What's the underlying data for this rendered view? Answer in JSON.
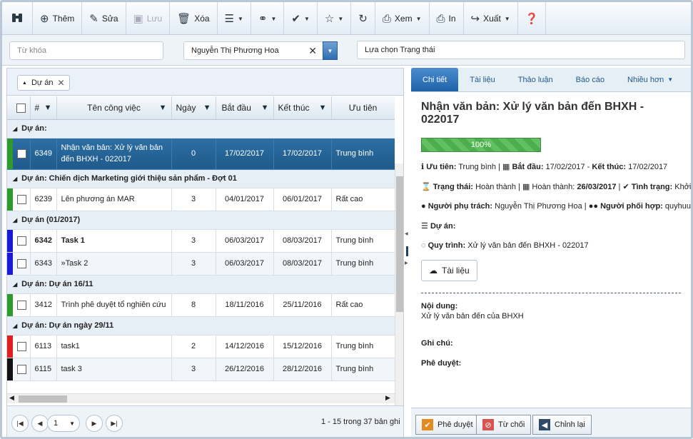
{
  "toolbar": {
    "binoculars": "",
    "add": "Thêm",
    "edit": "Sửa",
    "save": "Lưu",
    "delete": "Xóa",
    "view": "Xem",
    "print": "In",
    "export": "Xuất"
  },
  "filters": {
    "keyword_placeholder": "Từ khóa",
    "person_value": "Nguyễn Thị Phương Hoa",
    "status_placeholder": "Lựa chọn Trạng thái"
  },
  "group_chip": "Dự án",
  "grid": {
    "headers": [
      "#",
      "Tên công việc",
      "Ngày",
      "Bắt đầu",
      "Kết thúc",
      "Ưu tiên"
    ],
    "groups": [
      {
        "title": "Dự án:",
        "rows": [
          {
            "id": "6349",
            "name": "Nhận văn bản: Xử lý văn bản đến BHXH - 022017",
            "days": "0",
            "start": "17/02/2017",
            "end": "17/02/2017",
            "priority": "Trung bình",
            "bar": "#2e9a2e",
            "selected": true,
            "bold": false
          }
        ]
      },
      {
        "title": "Dự án: Chiến dịch Marketing giới thiệu sản phẩm - Đợt 01",
        "rows": [
          {
            "id": "6239",
            "name": "Lên phương án MAR",
            "days": "3",
            "start": "04/01/2017",
            "end": "06/01/2017",
            "priority": "Rất cao",
            "bar": "#2e9a2e",
            "selected": false,
            "bold": false
          }
        ]
      },
      {
        "title": "Dự án (01/2017)",
        "rows": [
          {
            "id": "6342",
            "name": "Task 1",
            "days": "3",
            "start": "06/03/2017",
            "end": "08/03/2017",
            "priority": "Trung bình",
            "bar": "#1a1ad6",
            "selected": false,
            "bold": true
          },
          {
            "id": "6343",
            "name": "»Task 2",
            "days": "3",
            "start": "06/03/2017",
            "end": "08/03/2017",
            "priority": "Trung bình",
            "bar": "#1a1ad6",
            "selected": false,
            "bold": false
          }
        ]
      },
      {
        "title": "Dự án: Dự án 16/11",
        "rows": [
          {
            "id": "3412",
            "name": "Trình phê duyệt tổ nghiên cứu",
            "days": "8",
            "start": "18/11/2016",
            "end": "25/11/2016",
            "priority": "Rất cao",
            "bar": "#2e9a2e",
            "selected": false,
            "bold": false
          }
        ]
      },
      {
        "title": "Dự án: Dự án ngày 29/11",
        "rows": [
          {
            "id": "6113",
            "name": "task1",
            "days": "2",
            "start": "14/12/2016",
            "end": "15/12/2016",
            "priority": "Trung bình",
            "bar": "#e02020",
            "selected": false,
            "bold": false
          },
          {
            "id": "6115",
            "name": "task 3",
            "days": "3",
            "start": "26/12/2016",
            "end": "28/12/2016",
            "priority": "Trung bình",
            "bar": "#111111",
            "selected": false,
            "bold": false
          }
        ]
      }
    ]
  },
  "pager": {
    "page": "1",
    "summary": "1 - 15 trong 37 bản ghi"
  },
  "tabs": [
    "Chi tiết",
    "Tài liệu",
    "Thảo luận",
    "Báo cáo",
    "Nhiều hơn"
  ],
  "detail": {
    "title": "Nhận văn bản: Xử lý văn bản đến BHXH - 022017",
    "progress_label": "100%",
    "progress": 1.0,
    "priority_label": "Ưu tiên:",
    "priority": "Trung bình",
    "start_label": "Bắt đầu:",
    "start": "17/02/2017",
    "end_label": "Kết thúc:",
    "end": "17/02/2017",
    "status_label": "Trạng thái:",
    "status": "Hoàn thành",
    "done_label": "Hoàn thành:",
    "done": "26/03/2017",
    "state_label": "Tình trạng:",
    "state": "Khởi tạo",
    "owner_label": "Người phụ trách:",
    "owner": "Nguyễn Thị Phương Hoa",
    "collab_label": "Người phối hợp:",
    "collab": "quyhuu",
    "project_label": "Dự án:",
    "process_label": "Quy trình:",
    "process": "Xử lý văn bản đến BHXH - 022017",
    "docs_button": "Tài liệu",
    "content_label": "Nội dung:",
    "content": "Xử lý văn bản đến của BHXH",
    "note_label": "Ghi chú:",
    "approval_label": "Phê duyệt:"
  },
  "footer": {
    "approve": "Phê duyệt",
    "reject": "Từ chối",
    "revise": "Chỉnh lại"
  }
}
